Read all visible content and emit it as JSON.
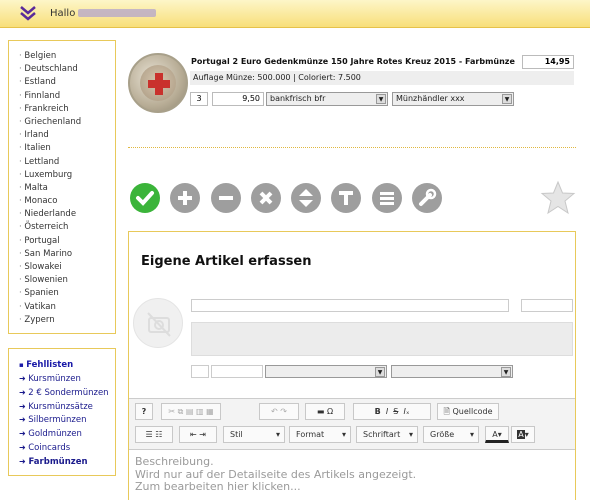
{
  "header": {
    "greeting": "Hallo",
    "username": ""
  },
  "countries": [
    "Belgien",
    "Deutschland",
    "Estland",
    "Finnland",
    "Frankreich",
    "Griechenland",
    "Irland",
    "Italien",
    "Lettland",
    "Luxemburg",
    "Malta",
    "Monaco",
    "Niederlande",
    "Österreich",
    "Portugal",
    "San Marino",
    "Slowakei",
    "Slowenien",
    "Spanien",
    "Vatikan",
    "Zypern"
  ],
  "lists": {
    "head": "Fehllisten",
    "items": [
      "Kursmünzen",
      "2 € Sondermünzen",
      "Kursmünzsätze",
      "Silbermünzen",
      "Goldmünzen",
      "Coincards",
      "Farbmünzen"
    ]
  },
  "product": {
    "title": "Portugal 2 Euro Gedenkmünze 150 Jahre Rotes Kreuz 2015 - Farbmünze",
    "price": "14,95",
    "info": "Auflage Münze: 500.000 | Coloriert: 7.500",
    "quantity": "3",
    "unit_price": "9,50",
    "condition": "bankfrisch bfr",
    "dealer": "Münzhändler xxx"
  },
  "actions": [
    "check-icon",
    "plus-icon",
    "minus-icon",
    "close-icon",
    "up-down-icon",
    "text-icon",
    "list-icon",
    "wrench-icon"
  ],
  "editor": {
    "title": "Eigene Artikel erfassen",
    "toolbar": {
      "help": "?",
      "source": "Quellcode",
      "style": "Stil",
      "format": "Format",
      "font": "Schriftart",
      "size": "Größe",
      "bold": "B",
      "italic": "I",
      "strike": "S",
      "omega": "Ω",
      "text_color": "A",
      "bg_color": "A"
    },
    "placeholder_lines": [
      "Beschreibung.",
      "Wird nur auf der Detailseite des Artikels angezeigt.",
      "Zum bearbeiten hier klicken..."
    ]
  },
  "colors": {
    "accent": "#3bb43a",
    "link": "#1a1aa8",
    "border": "#e8c95a"
  }
}
